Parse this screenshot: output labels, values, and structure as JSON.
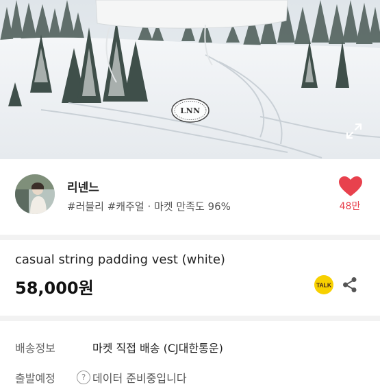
{
  "hero": {
    "logo_text": "LNN",
    "expand_icon": "expand-icon"
  },
  "seller": {
    "name": "리넨느",
    "tags": "#러블리 #캐주얼 · 마켓 만족도 96%",
    "like_count": "48만",
    "heart_icon": "heart-icon",
    "heart_color": "#e8414d"
  },
  "product": {
    "title": "casual string padding vest (white)",
    "price": "58,000원",
    "talk_label": "TALK",
    "share_icon": "share-icon"
  },
  "shipping": {
    "rows": [
      {
        "label": "배송정보",
        "value": "마켓 직접 배송 (CJ대한통운)"
      },
      {
        "label": "출발예정",
        "help": "?",
        "value": "데이터 준비중입니다"
      }
    ]
  },
  "colors": {
    "accent": "#e8414d",
    "talk_yellow": "#f7d000"
  }
}
